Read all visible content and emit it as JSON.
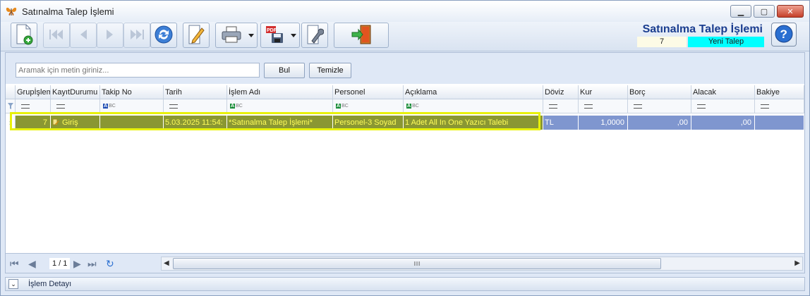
{
  "window": {
    "title": "Satınalma Talep İşlemi",
    "icon": "butterfly-icon"
  },
  "window_controls": {
    "minimize": "minimize-icon",
    "maximize": "maximize-icon",
    "close": "close-icon"
  },
  "toolbar": {
    "buttons": [
      {
        "name": "new-record-button",
        "icon": "new-document-plus-icon"
      },
      {
        "name": "first-record-button",
        "icon": "first-icon"
      },
      {
        "name": "previous-record-button",
        "icon": "previous-icon"
      },
      {
        "name": "next-record-button",
        "icon": "next-icon"
      },
      {
        "name": "last-record-button",
        "icon": "last-icon"
      },
      {
        "name": "refresh-button",
        "icon": "refresh-icon"
      },
      {
        "name": "edit-button",
        "icon": "edit-pencil-icon"
      },
      {
        "name": "print-button",
        "icon": "printer-icon"
      },
      {
        "name": "export-pdf-button",
        "icon": "pdf-save-icon"
      },
      {
        "name": "settings-button",
        "icon": "wrench-icon"
      },
      {
        "name": "exit-button",
        "icon": "exit-door-icon"
      }
    ]
  },
  "header": {
    "title": "Satınalma Talep İşlemi",
    "record_number": "7",
    "status": "Yeni Talep",
    "status_color": "#00ffff",
    "help_icon": "help-icon"
  },
  "search": {
    "placeholder": "Aramak için metin giriniz...",
    "find_label": "Bul",
    "clear_label": "Temizle"
  },
  "grid": {
    "columns": [
      "GrupİşlemNo",
      "KayıtDurumu",
      "Takip No",
      "Tarih",
      "İşlem Adı",
      "Personel",
      "Açıklama",
      "Döviz",
      "Kur",
      "Borç",
      "Alacak",
      "Bakiye"
    ],
    "rows": [
      {
        "grup": "7",
        "kayit_durumu": "Giriş",
        "takip_no": "",
        "tarih": "5.03.2025 11:54:",
        "islem_adi": "*Satınalma Talep İşlemi*",
        "personel": "Personel-3 Soyad",
        "aciklama": "1 Adet All In One Yazıcı Talebi",
        "doviz": "TL",
        "kur": "1,0000",
        "borc": ",00",
        "alacak": ",00",
        "bakiye": ""
      }
    ],
    "highlight_color": "#e8f10a"
  },
  "navigator": {
    "page": "1 / 1",
    "scroll_grip": "IIII"
  },
  "detail": {
    "label": "İşlem Detayı"
  }
}
